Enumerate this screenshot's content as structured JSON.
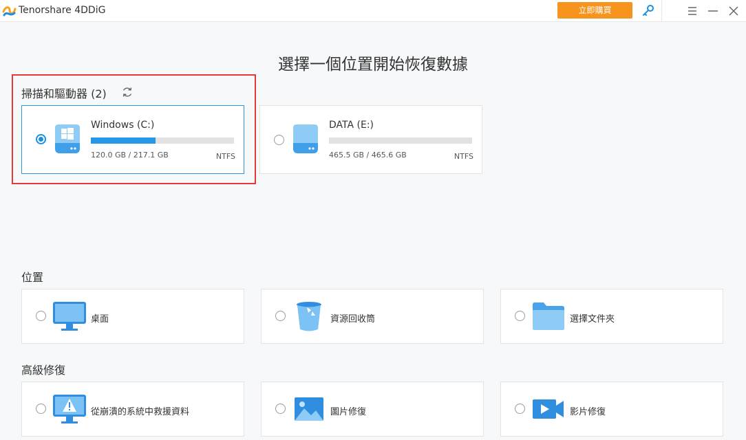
{
  "app": {
    "title": "Tenorshare 4DDiG",
    "buy_label": "立即購買"
  },
  "icons": {
    "logo": "tenorshare-logo",
    "key": "key-icon",
    "menu": "menu-icon",
    "minimize": "minimize-icon",
    "close": "close-icon",
    "refresh": "refresh-icon"
  },
  "colors": {
    "accent": "#2596e8",
    "buy": "#f7941d",
    "highlight": "#e53935"
  },
  "main": {
    "title": "選擇一個位置開始恢復數據"
  },
  "drives": {
    "section_label": "掃描和驅動器 (2)",
    "items": [
      {
        "name": "Windows (C:)",
        "size": "120.0 GB / 217.1 GB",
        "fs": "NTFS",
        "used_fraction": 0.45,
        "selected": true
      },
      {
        "name": "DATA (E:)",
        "size": "465.5 GB / 465.6 GB",
        "fs": "NTFS",
        "used_fraction": 0.0,
        "selected": false
      }
    ]
  },
  "locations": {
    "section_label": "位置",
    "items": [
      {
        "label": "桌面",
        "icon": "desktop-icon"
      },
      {
        "label": "資源回收筒",
        "icon": "recycle-bin-icon"
      },
      {
        "label": "選擇文件夾",
        "icon": "folder-icon"
      }
    ]
  },
  "advanced": {
    "section_label": "高級修復",
    "items": [
      {
        "label": "從崩潰的系統中救援資料",
        "icon": "crashed-system-icon"
      },
      {
        "label": "圖片修復",
        "icon": "photo-repair-icon"
      },
      {
        "label": "影片修復",
        "icon": "video-repair-icon"
      }
    ]
  }
}
